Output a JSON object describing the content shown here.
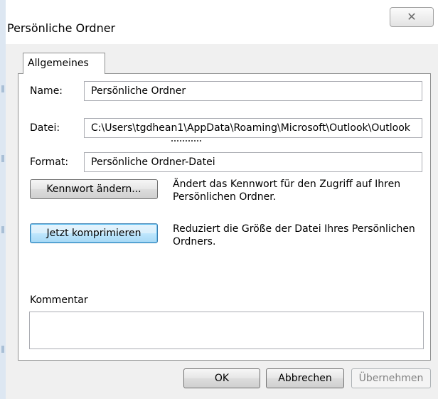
{
  "window": {
    "title": "Persönliche Ordner",
    "close_symbol": "✕"
  },
  "tabs": [
    {
      "label": "Allgemeines",
      "active": true
    }
  ],
  "fields": {
    "name_label": "Name:",
    "name_value": "Persönliche Ordner",
    "file_label": "Datei:",
    "file_value": "C:\\Users\\tgdhean1\\AppData\\Roaming\\Microsoft\\Outlook\\Outlook",
    "format_label": "Format:",
    "format_value": "Persönliche Ordner-Datei"
  },
  "actions": {
    "change_password_label": "Kennwort ändern...",
    "change_password_desc": "Ändert das Kennwort für den Zugriff auf Ihren Persönlichen Ordner.",
    "compact_label": "Jetzt komprimieren",
    "compact_desc": "Reduziert die Größe der Datei Ihres Persönlichen Ordners."
  },
  "comment": {
    "label": "Kommentar",
    "value": ""
  },
  "buttons": {
    "ok": "OK",
    "cancel": "Abbrechen",
    "apply": "Übernehmen"
  },
  "colors": {
    "dialog_bg": "#f0f0f0",
    "focus_border": "#3c7fb1",
    "disabled_text": "#838383"
  },
  "icons": {
    "close": "close-icon"
  }
}
